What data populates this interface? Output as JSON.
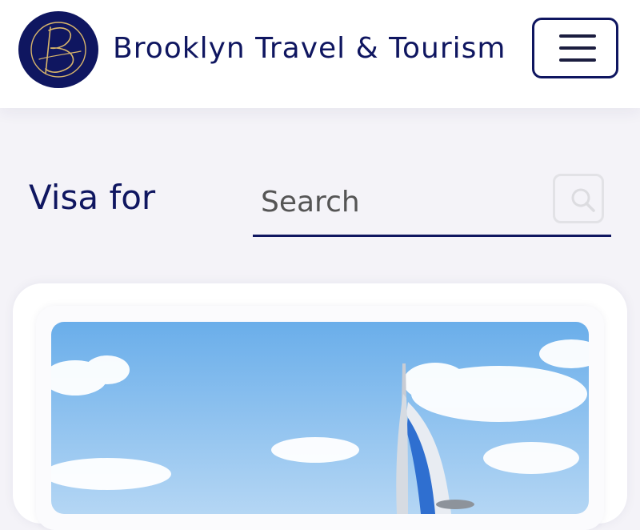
{
  "header": {
    "brand": "Brooklyn Travel & Tourism",
    "logo_icon": "brooklyn-b-monogram",
    "menu_icon": "hamburger-icon"
  },
  "visa": {
    "label": "Visa for",
    "search_placeholder": "Search",
    "search_icon": "search-icon"
  },
  "card": {
    "image": "burj-al-arab-sky-photo"
  },
  "colors": {
    "brand_navy": "#0f1660",
    "logo_gold": "#d8b56a",
    "background": "#f4f3f8"
  }
}
